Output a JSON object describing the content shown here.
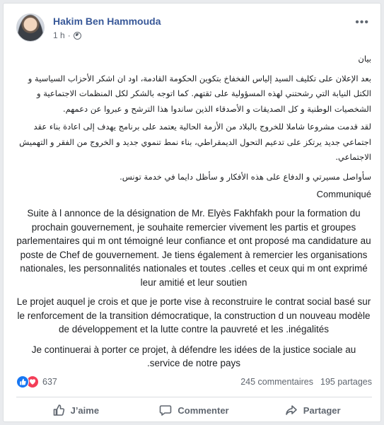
{
  "post": {
    "author": "Hakim Ben Hammouda",
    "time": "1 h",
    "separator": "·",
    "more_icon": "more-horizontal-icon",
    "privacy_icon": "globe-icon",
    "arabic": {
      "title": "بيان",
      "p1": "بعد الإعلان على تكليف السيد إلياس الفخفاخ بتكوين الحكومة القادمة، اود ان اشكر الأحزاب السياسية و الكتل النيابة التي رشحتني لهذه المسؤولية على ثقتهم. كما اتوجه بالشكر لكل المنظمات الاجتماعية و الشخصيات الوطنية و كل الصديقات و الأصدقاء الذين ساندوا هذا الترشح و عبروا عن دعمهم.",
      "p2": "لقد قدمت مشروعا شاملا للخروج بالبلاد من الأزمة الحالية يعتمد على برنامج يهدف إلى اعادة بناء عقد اجتماعي جديد يرتكز على تدعيم التحول الديمقراطي، بناء نمط تنموي جديد و الخروج من الفقر و التهميش الاجتماعي.",
      "p3": "سأواصل مسيرتي و الدفاع على هذه الأفكار و سأظل دايما في خدمة تونس."
    },
    "french": {
      "title": "Communiqué",
      "p1": "Suite à l annonce de la désignation de Mr. Elyès Fakhfakh pour la formation du prochain gouvernement, je souhaite remercier vivement les partis et groupes parlementaires qui m ont témoigné leur confiance et ont proposé ma candidature au poste de Chef de gouvernement. Je tiens également à remercier les organisations nationales, les personnalités nationales et toutes .celles et ceux qui m ont exprimé leur amitié et leur soutien",
      "p2": "Le projet auquel je crois et que je porte vise à reconstruire le contrat social basé sur le renforcement de la transition démocratique, la construction d un nouveau modèle de développement et la lutte contre la pauvreté et les .inégalités",
      "p3": "Je continuerai à porter ce projet, à défendre les idées de la justice sociale au .service de notre pays"
    }
  },
  "stats": {
    "reactions": "637",
    "comments": "245 commentaires",
    "shares": "195 partages",
    "reaction_icons": [
      "like-icon",
      "love-icon"
    ]
  },
  "actions": {
    "like": "J’aime",
    "comment": "Commenter",
    "share": "Partager"
  },
  "colors": {
    "author_link": "#385898",
    "secondary_text": "#606770",
    "like_blue": "#1877f2",
    "love_red": "#f33e58",
    "page_background": "#e9ebee"
  }
}
